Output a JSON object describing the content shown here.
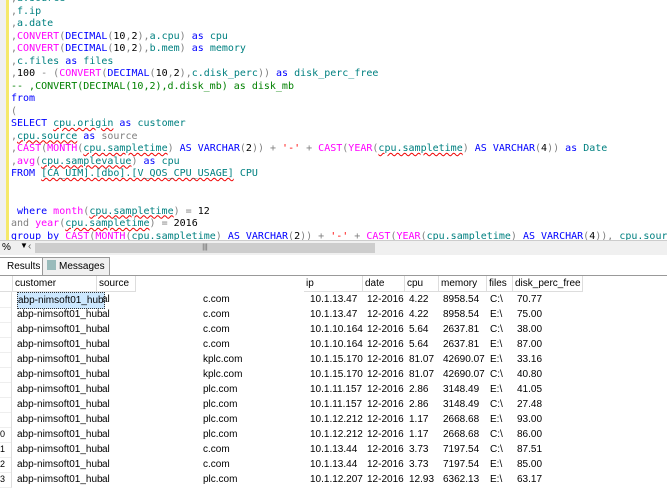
{
  "editor": {
    "lines_note": "sql"
  },
  "status": {
    "zoom": "%"
  },
  "tabs": {
    "results": "Results",
    "messages": "Messages"
  },
  "grid": {
    "columns": [
      "customer",
      "source",
      "ip",
      "date",
      "cpu",
      "memory",
      "files",
      "disk_perc_free"
    ],
    "rows": [
      [
        "abp-nimsoft01_hub",
        "al",
        "c.com",
        "10.1.13.47",
        "12-2016",
        "4.22",
        "8958.54",
        "C:\\",
        "70.77"
      ],
      [
        "abp-nimsoft01_hub",
        "al",
        "c.com",
        "10.1.13.47",
        "12-2016",
        "4.22",
        "8958.54",
        "E:\\",
        "75.00"
      ],
      [
        "abp-nimsoft01_hub",
        "al",
        "c.com",
        "10.1.10.164",
        "12-2016",
        "5.64",
        "2637.81",
        "C:\\",
        "38.00"
      ],
      [
        "abp-nimsoft01_hub",
        "al",
        "c.com",
        "10.1.10.164",
        "12-2016",
        "5.64",
        "2637.81",
        "E:\\",
        "87.00"
      ],
      [
        "abp-nimsoft01_hub",
        "al",
        "kplc.com",
        "10.1.15.170",
        "12-2016",
        "81.07",
        "42690.07",
        "E:\\",
        "33.16"
      ],
      [
        "abp-nimsoft01_hub",
        "al",
        "kplc.com",
        "10.1.15.170",
        "12-2016",
        "81.07",
        "42690.07",
        "C:\\",
        "40.80"
      ],
      [
        "abp-nimsoft01_hub",
        "al",
        "plc.com",
        "10.1.11.157",
        "12-2016",
        "2.86",
        "3148.49",
        "E:\\",
        "41.05"
      ],
      [
        "abp-nimsoft01_hub",
        "al",
        "plc.com",
        "10.1.11.157",
        "12-2016",
        "2.86",
        "3148.49",
        "C:\\",
        "27.48"
      ],
      [
        "abp-nimsoft01_hub",
        "al",
        "plc.com",
        "10.1.12.212",
        "12-2016",
        "1.17",
        "2668.68",
        "E:\\",
        "93.00"
      ],
      [
        "abp-nimsoft01_hub",
        "al",
        "plc.com",
        "10.1.12.212",
        "12-2016",
        "1.17",
        "2668.68",
        "C:\\",
        "86.00"
      ],
      [
        "abp-nimsoft01_hub",
        "al",
        "c.com",
        "10.1.13.44",
        "12-2016",
        "3.73",
        "7197.54",
        "C:\\",
        "87.51"
      ],
      [
        "abp-nimsoft01_hub",
        "al",
        "c.com",
        "10.1.13.44",
        "12-2016",
        "3.73",
        "7197.54",
        "E:\\",
        "85.00"
      ],
      [
        "abp-nimsoft01_hub",
        "al",
        "plc.com",
        "10.1.12.207",
        "12-2016",
        "12.93",
        "6362.13",
        "E:\\",
        "63.17"
      ]
    ],
    "row_numbers": [
      "",
      "",
      "",
      "",
      "",
      "",
      "",
      "",
      "",
      "0",
      "1",
      "2",
      "3"
    ]
  }
}
